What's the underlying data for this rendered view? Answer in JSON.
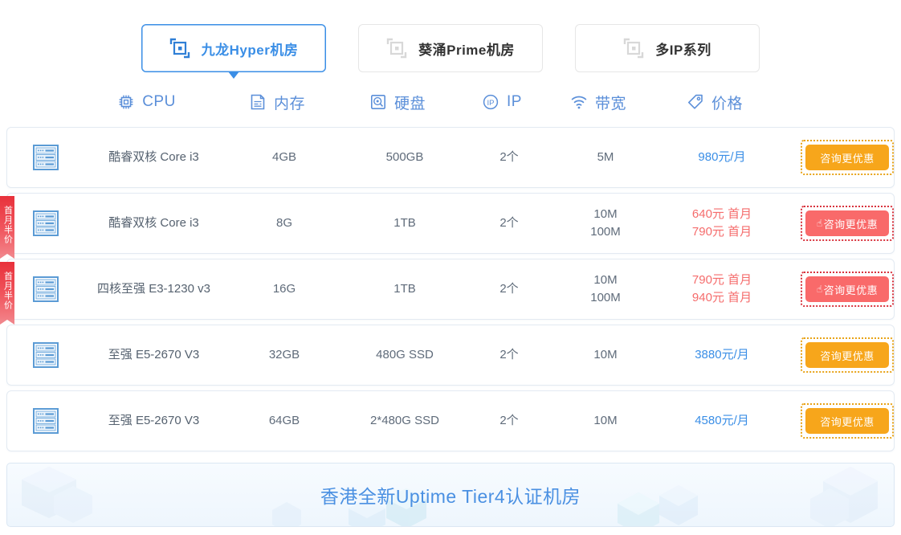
{
  "tabs": [
    {
      "label": "九龙Hyper机房",
      "icon": "datacenter-icon",
      "active": true
    },
    {
      "label": "葵涌Prime机房",
      "icon": "datacenter-icon",
      "active": false
    },
    {
      "label": "多IP系列",
      "icon": "datacenter-icon",
      "active": false
    }
  ],
  "columns": [
    {
      "label": "CPU",
      "icon": "cpu-icon"
    },
    {
      "label": "内存",
      "icon": "memory-icon"
    },
    {
      "label": "硬盘",
      "icon": "harddisk-icon"
    },
    {
      "label": "IP",
      "icon": "ip-icon"
    },
    {
      "label": "带宽",
      "icon": "bandwidth-icon"
    },
    {
      "label": "价格",
      "icon": "price-tag-icon"
    }
  ],
  "rows": [
    {
      "badge": null,
      "cpu": "酷睿双核 Core i3",
      "memory": "4GB",
      "disk": "500GB",
      "ip": "2个",
      "bandwidth": [
        "5M"
      ],
      "price": [
        "980元/月"
      ],
      "price_style": "normal",
      "button": {
        "label": "咨询更优惠",
        "style": "orange",
        "hand": false
      }
    },
    {
      "badge": "首月半价",
      "cpu": "酷睿双核 Core i3",
      "memory": "8G",
      "disk": "1TB",
      "ip": "2个",
      "bandwidth": [
        "10M",
        "100M"
      ],
      "price": [
        "640元 首月",
        "790元 首月"
      ],
      "price_style": "promo",
      "button": {
        "label": "咨询更优惠",
        "style": "red",
        "hand": true
      }
    },
    {
      "badge": "首月半价",
      "cpu": "四核至强 E3-1230 v3",
      "memory": "16G",
      "disk": "1TB",
      "ip": "2个",
      "bandwidth": [
        "10M",
        "100M"
      ],
      "price": [
        "790元 首月",
        "940元 首月"
      ],
      "price_style": "promo",
      "button": {
        "label": "咨询更优惠",
        "style": "red",
        "hand": true
      }
    },
    {
      "badge": null,
      "cpu": "至强 E5-2670 V3",
      "memory": "32GB",
      "disk": "480G SSD",
      "ip": "2个",
      "bandwidth": [
        "10M"
      ],
      "price": [
        "3880元/月"
      ],
      "price_style": "normal",
      "button": {
        "label": "咨询更优惠",
        "style": "orange",
        "hand": false
      }
    },
    {
      "badge": null,
      "cpu": "至强 E5-2670 V3",
      "memory": "64GB",
      "disk": "2*480G SSD",
      "ip": "2个",
      "bandwidth": [
        "10M"
      ],
      "price": [
        "4580元/月"
      ],
      "price_style": "normal",
      "button": {
        "label": "咨询更优惠",
        "style": "orange",
        "hand": false
      }
    }
  ],
  "banner": {
    "text": "香港全新Uptime Tier4认证机房"
  },
  "colors": {
    "accent_blue": "#3a8ee6",
    "header_blue": "#5b8fd9",
    "orange": "#f7a61b",
    "orange_border": "#e8a317",
    "red": "#f96a6a",
    "red_border": "#d8333d",
    "promo_text": "#f56c6c",
    "ribbon": "#e8313b"
  }
}
